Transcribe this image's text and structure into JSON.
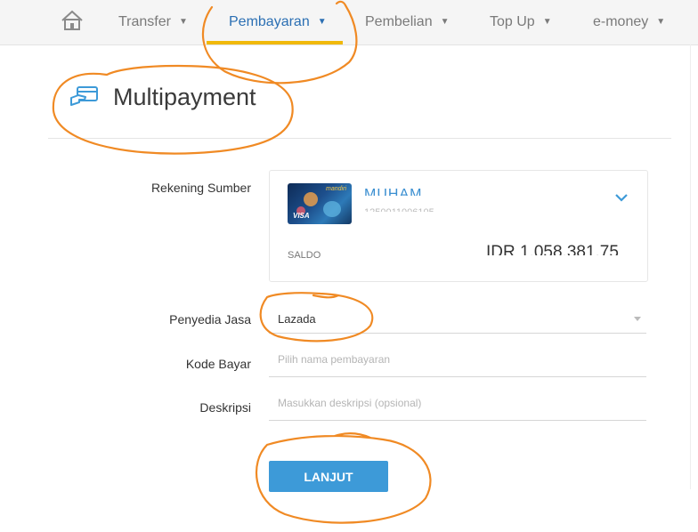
{
  "nav": {
    "items": [
      {
        "label": "Transfer"
      },
      {
        "label": "Pembayaran",
        "active": true
      },
      {
        "label": "Pembelian"
      },
      {
        "label": "Top Up"
      },
      {
        "label": "e-money"
      }
    ],
    "accent_color": "#f0b90b",
    "active_color": "#2b6fb3"
  },
  "page": {
    "title": "Multipayment",
    "icon": "credit-card-hand-icon"
  },
  "form": {
    "source_account": {
      "label": "Rekening Sumber",
      "name": "MUHAM",
      "number": "1250011006105",
      "balance_label": "SALDO",
      "balance": "IDR 1.058.381,75"
    },
    "service_provider": {
      "label": "Penyedia Jasa",
      "value": "Lazada"
    },
    "payment_code": {
      "label": "Kode Bayar",
      "placeholder": "Pilih nama pembayaran"
    },
    "description": {
      "label": "Deskripsi",
      "placeholder": "Masukkan deskripsi (opsional)"
    },
    "submit_label": "LANJUT",
    "button_color": "#3d9ad8"
  },
  "annotation_color": "#f08a24"
}
